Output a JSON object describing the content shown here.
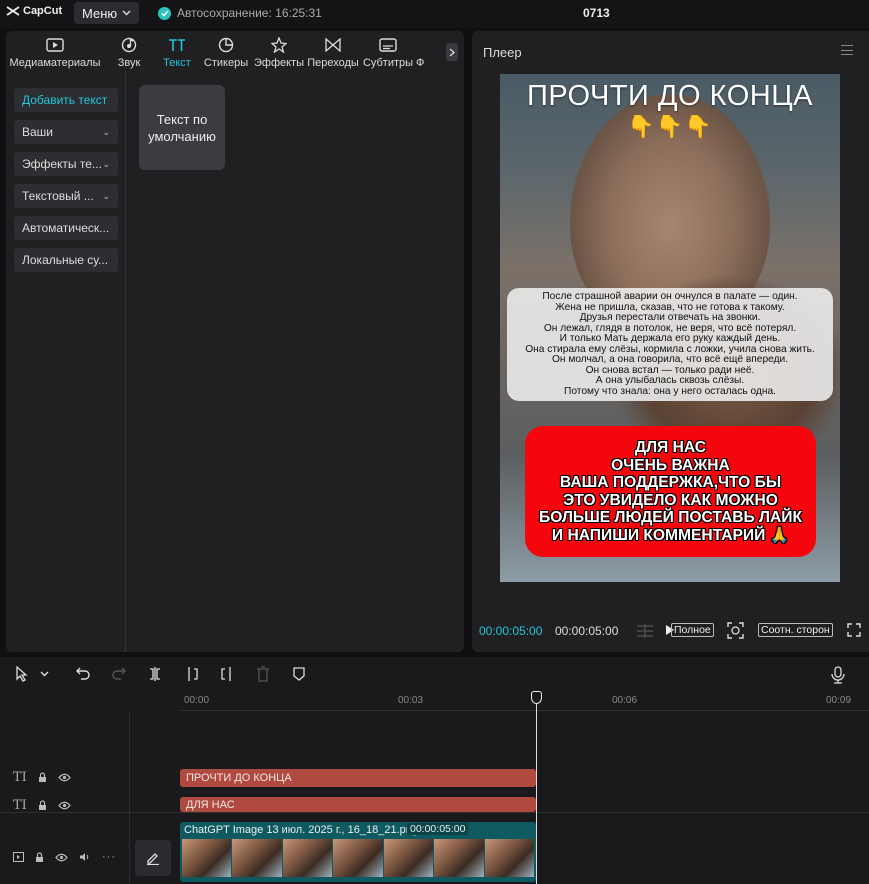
{
  "topbar": {
    "logo": "CapCut",
    "menu_label": "Меню",
    "autosave": "Автосохранение: 16:25:31",
    "project_name": "0713"
  },
  "tabs": [
    {
      "label": "Медиаматериалы",
      "icon": "media-icon"
    },
    {
      "label": "Звук",
      "icon": "audio-icon"
    },
    {
      "label": "Текст",
      "icon": "text-icon",
      "active": true
    },
    {
      "label": "Стикеры",
      "icon": "sticker-icon"
    },
    {
      "label": "Эффекты",
      "icon": "effects-icon"
    },
    {
      "label": "Переходы",
      "icon": "transitions-icon"
    },
    {
      "label": "Субтитры",
      "icon": "subtitles-icon"
    },
    {
      "label": "Ф",
      "icon": "filter-icon"
    }
  ],
  "sidebar": {
    "items": [
      {
        "label": "Добавить текст"
      },
      {
        "label": "Ваши"
      },
      {
        "label": "Эффекты те..."
      },
      {
        "label": "Текстовый ..."
      },
      {
        "label": "Автоматическ..."
      },
      {
        "label": "Локальные су..."
      }
    ]
  },
  "text_card": "Текст по умолчанию",
  "player": {
    "title": "Плеер",
    "video_title": "ПРОЧТИ ДО КОНЦА",
    "pointing_hands": "👇👇👇",
    "story_lines": [
      "После страшной аварии он очнулся в палате — один.",
      "Жена не пришла, сказав, что не готова к такому.",
      "Друзья перестали отвечать на звонки.",
      "Он лежал, глядя в потолок, не веря, что всё потерял.",
      "И только Мать держала его руку каждый день.",
      "Она стирала ему слёзы, кормила с ложки, учила снова жить.",
      "Он молчал, а она говорила, что всё ещё впереди.",
      "Он снова встал — только ради неё.",
      "А она улыбалась сквозь слёзы.",
      "Потому что знала: она у него осталась одна."
    ],
    "red_lines": [
      "ДЛЯ НАС",
      "ОЧЕНЬ ВАЖНА",
      "ВАША ПОДДЕРЖКА,ЧТО БЫ",
      "ЭТО УВИДЕЛО КАК МОЖНО",
      "БОЛЬШЕ ЛЮДЕЙ ПОСТАВЬ ЛАЙК",
      "И НАПИШИ КОММЕНТАРИЙ 🙏"
    ],
    "current_time": "00:00:05:00",
    "total_time": "00:00:05:00",
    "full_label": "Полное",
    "ratio_label": "Соотн. сторон"
  },
  "timeline": {
    "ticks": [
      "00:00",
      "00:03",
      "00:06",
      "00:09"
    ],
    "text_clip_1": "ПРОЧТИ ДО КОНЦА",
    "text_clip_2": "ДЛЯ НАС",
    "video_clip_name": "ChatGPT Image 13 июл. 2025 г., 16_18_21.png",
    "video_clip_duration": "00:00:05:00",
    "frame_count": 7
  },
  "colors": {
    "accent": "#22c5d8",
    "text_clip": "#b04a41",
    "video_clip": "#0f5a60",
    "red_banner": "#f5060d"
  }
}
